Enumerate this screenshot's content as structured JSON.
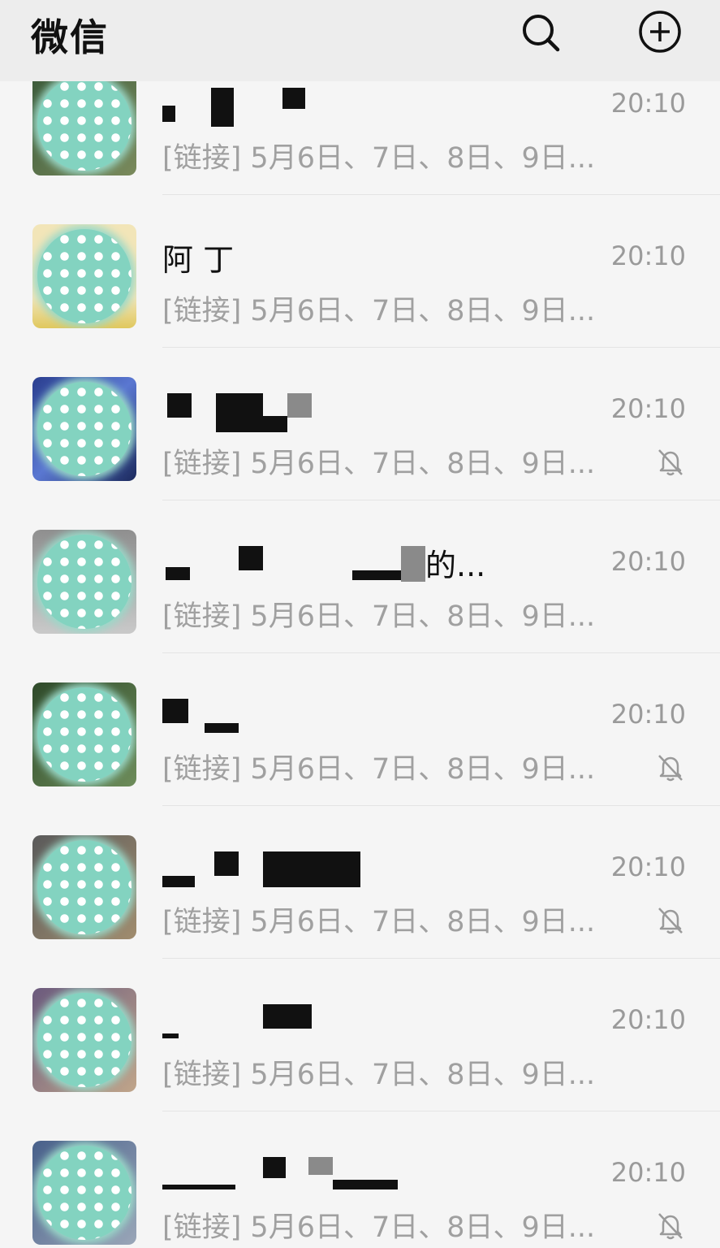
{
  "header": {
    "title": "微信",
    "search_icon": "search-icon",
    "add_icon": "plus-circle-icon"
  },
  "chats": [
    {
      "name": "",
      "time": "20:10",
      "preview": "[链接] 5月6日、7日、8日、9日...",
      "muted": false,
      "avatar_colors": [
        "#3b5a3a",
        "#7a8a5c"
      ]
    },
    {
      "name": "阿 丁",
      "time": "20:10",
      "preview": "[链接] 5月6日、7日、8日、9日...",
      "muted": false,
      "avatar_colors": [
        "#f2e5b8",
        "#e0c85e"
      ]
    },
    {
      "name": "",
      "time": "20:10",
      "preview": "[链接] 5月6日、7日、8日、9日...",
      "muted": true,
      "avatar_colors": [
        "#2a3e8f",
        "#5a77d1"
      ]
    },
    {
      "name": "的...",
      "time": "20:10",
      "preview": "[链接] 5月6日、7日、8日、9日...",
      "muted": false,
      "avatar_colors": [
        "#8f8f8f",
        "#c9c9c9"
      ]
    },
    {
      "name": "",
      "time": "20:10",
      "preview": "[链接] 5月6日、7日、8日、9日...",
      "muted": true,
      "avatar_colors": [
        "#2f4a2a",
        "#6d8c5a"
      ]
    },
    {
      "name": "",
      "time": "20:10",
      "preview": "[链接] 5月6日、7日、8日、9日...",
      "muted": true,
      "avatar_colors": [
        "#5a5a5a",
        "#a08c6e"
      ]
    },
    {
      "name": "",
      "time": "20:10",
      "preview": "[链接] 5月6日、7日、8日、9日...",
      "muted": false,
      "avatar_colors": [
        "#6b5a7d",
        "#c0a58a"
      ]
    },
    {
      "name": "",
      "time": "20:10",
      "preview": "[链接] 5月6日、7日、8日、9日...",
      "muted": true,
      "avatar_colors": [
        "#48608a",
        "#9aa6b8"
      ]
    }
  ]
}
